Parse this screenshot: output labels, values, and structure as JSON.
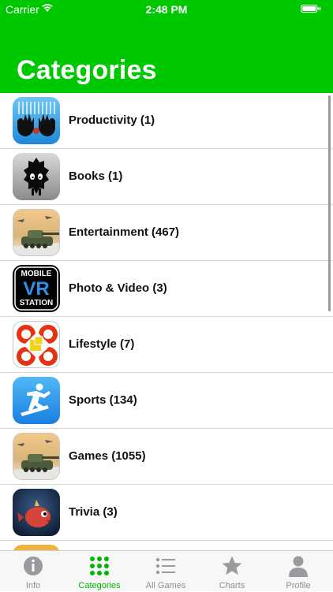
{
  "status_bar": {
    "carrier": "Carrier",
    "time": "2:48 PM"
  },
  "nav": {
    "title": "Categories"
  },
  "categories": [
    {
      "label": "Productivity (1)",
      "icon": "hands-icon"
    },
    {
      "label": "Books (1)",
      "icon": "shadow-creature-icon"
    },
    {
      "label": "Entertainment (467)",
      "icon": "tank-icon"
    },
    {
      "label": "Photo & Video (3)",
      "icon": "mobile-vr-station-icon",
      "icon_text": [
        "MOBILE",
        "VR",
        "STATION"
      ]
    },
    {
      "label": "Lifestyle (7)",
      "icon": "lifestyle-pattern-icon"
    },
    {
      "label": "Sports (134)",
      "icon": "snowboarder-icon"
    },
    {
      "label": "Games (1055)",
      "icon": "tank-icon"
    },
    {
      "label": "Trivia (3)",
      "icon": "pufferfish-icon"
    }
  ],
  "tabbar": {
    "tabs": [
      {
        "label": "Info",
        "icon": "info-icon",
        "active": false
      },
      {
        "label": "Categories",
        "icon": "grid-icon",
        "active": true
      },
      {
        "label": "All Games",
        "icon": "list-icon",
        "active": false
      },
      {
        "label": "Charts",
        "icon": "star-icon",
        "active": false
      },
      {
        "label": "Profile",
        "icon": "person-icon",
        "active": false
      }
    ]
  },
  "colors": {
    "accent": "#00c800",
    "tab_active": "#00b400",
    "tab_inactive": "#8e8e93"
  }
}
